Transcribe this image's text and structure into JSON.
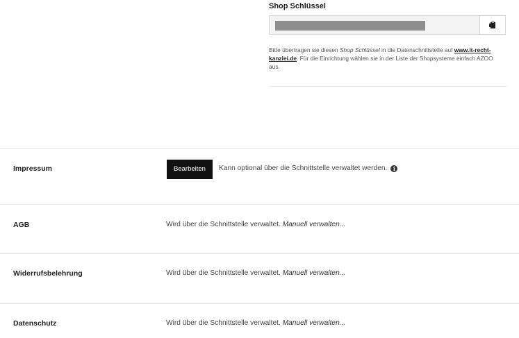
{
  "shop_key": {
    "label": "Shop Schlüssel",
    "help_part1": "Bitte übertragen sie diesen ",
    "help_emphasis": "Shop Schlüssel",
    "help_part2": " in die Datenschnittstelle auf ",
    "help_link": "www.it-recht-kanzlei.de",
    "help_part3": ". Für die Einrichtung wählen sie in der Liste der Shopsysteme einfach AZOO aus.",
    "copy_icon": "clipboard-icon"
  },
  "rows": [
    {
      "title": "Impressum",
      "button_label": "Bearbeiten",
      "note": "Kann optional über die Schnittstelle verwaltet werden.",
      "info_icon": "info-icon"
    },
    {
      "title": "AGB",
      "desc": "Wird über die Schnittstelle verwaltet.",
      "manual": "Manuell verwalten..."
    },
    {
      "title": "Widerrufsbelehrung",
      "desc": "Wird über die Schnittstelle verwaltet.",
      "manual": "Manuell verwalten..."
    },
    {
      "title": "Datenschutz",
      "desc": "Wird über die Schnittstelle verwaltet.",
      "manual": "Manuell verwalten..."
    }
  ]
}
